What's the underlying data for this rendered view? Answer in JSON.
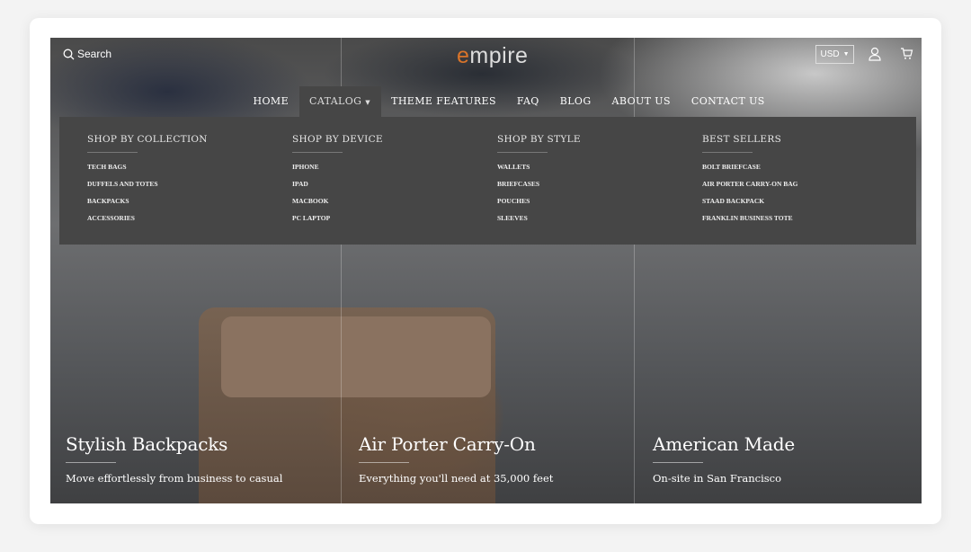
{
  "header": {
    "search_label": "Search",
    "logo_accent": "e",
    "logo_rest": "mpire",
    "currency": "USD"
  },
  "nav": [
    "HOME",
    "CATALOG",
    "THEME FEATURES",
    "FAQ",
    "BLOG",
    "ABOUT US",
    "CONTACT US"
  ],
  "dropdown": [
    {
      "title": "SHOP BY COLLECTION",
      "items": [
        "TECH BAGS",
        "DUFFELS AND TOTES",
        "BACKPACKS",
        "ACCESSORIES"
      ]
    },
    {
      "title": "SHOP BY DEVICE",
      "items": [
        "IPHONE",
        "IPAD",
        "MACBOOK",
        "PC LAPTOP"
      ]
    },
    {
      "title": "SHOP BY STYLE",
      "items": [
        "WALLETS",
        "BRIEFCASES",
        "POUCHES",
        "SLEEVES"
      ]
    },
    {
      "title": "BEST SELLERS",
      "items": [
        "BOLT BRIEFCASE",
        "AIR PORTER CARRY-ON BAG",
        "STAAD BACKPACK",
        "FRANKLIN BUSINESS TOTE"
      ]
    }
  ],
  "panels": [
    {
      "title": "Stylish Backpacks",
      "subtitle": "Move effortlessly from business to casual"
    },
    {
      "title": "Air Porter Carry-On",
      "subtitle": "Everything you'll need at 35,000 feet"
    },
    {
      "title": "American Made",
      "subtitle": "On-site in San Francisco"
    }
  ],
  "colors": {
    "accent": "#d9742a",
    "dropdown_bg": "#464646"
  }
}
